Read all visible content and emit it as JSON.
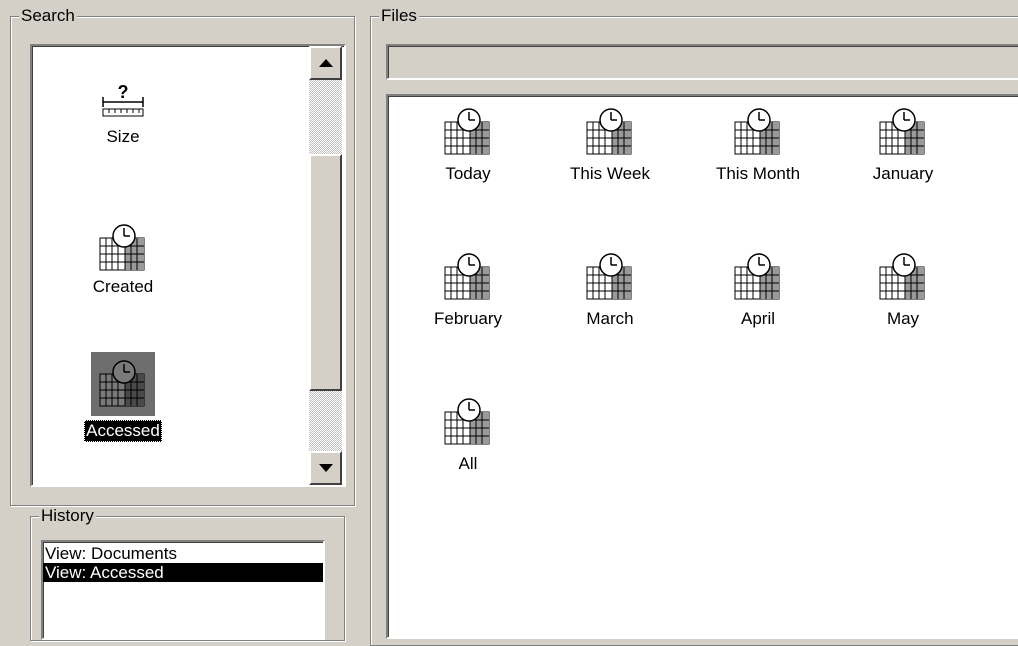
{
  "search": {
    "legend": "Search",
    "items": [
      {
        "label": "Size",
        "icon": "ruler-question-icon",
        "selected": false
      },
      {
        "label": "Created",
        "icon": "calendar-clock-icon",
        "selected": false
      },
      {
        "label": "Accessed",
        "icon": "calendar-clock-icon",
        "selected": true
      }
    ]
  },
  "history": {
    "legend": "History",
    "items": [
      {
        "label": "View: Documents",
        "selected": false
      },
      {
        "label": "View: Accessed",
        "selected": true
      }
    ]
  },
  "files": {
    "legend": "Files",
    "address": "",
    "items": [
      {
        "label": "Today",
        "icon": "calendar-clock-icon"
      },
      {
        "label": "This Week",
        "icon": "calendar-clock-icon"
      },
      {
        "label": "This Month",
        "icon": "calendar-clock-icon"
      },
      {
        "label": "January",
        "icon": "calendar-clock-icon"
      },
      {
        "label": "February",
        "icon": "calendar-clock-icon"
      },
      {
        "label": "March",
        "icon": "calendar-clock-icon"
      },
      {
        "label": "April",
        "icon": "calendar-clock-icon"
      },
      {
        "label": "May",
        "icon": "calendar-clock-icon"
      },
      {
        "label": "All",
        "icon": "calendar-clock-icon"
      }
    ]
  },
  "colors": {
    "face": "#d4d0c8",
    "selection": "#000000",
    "window": "#ffffff"
  }
}
